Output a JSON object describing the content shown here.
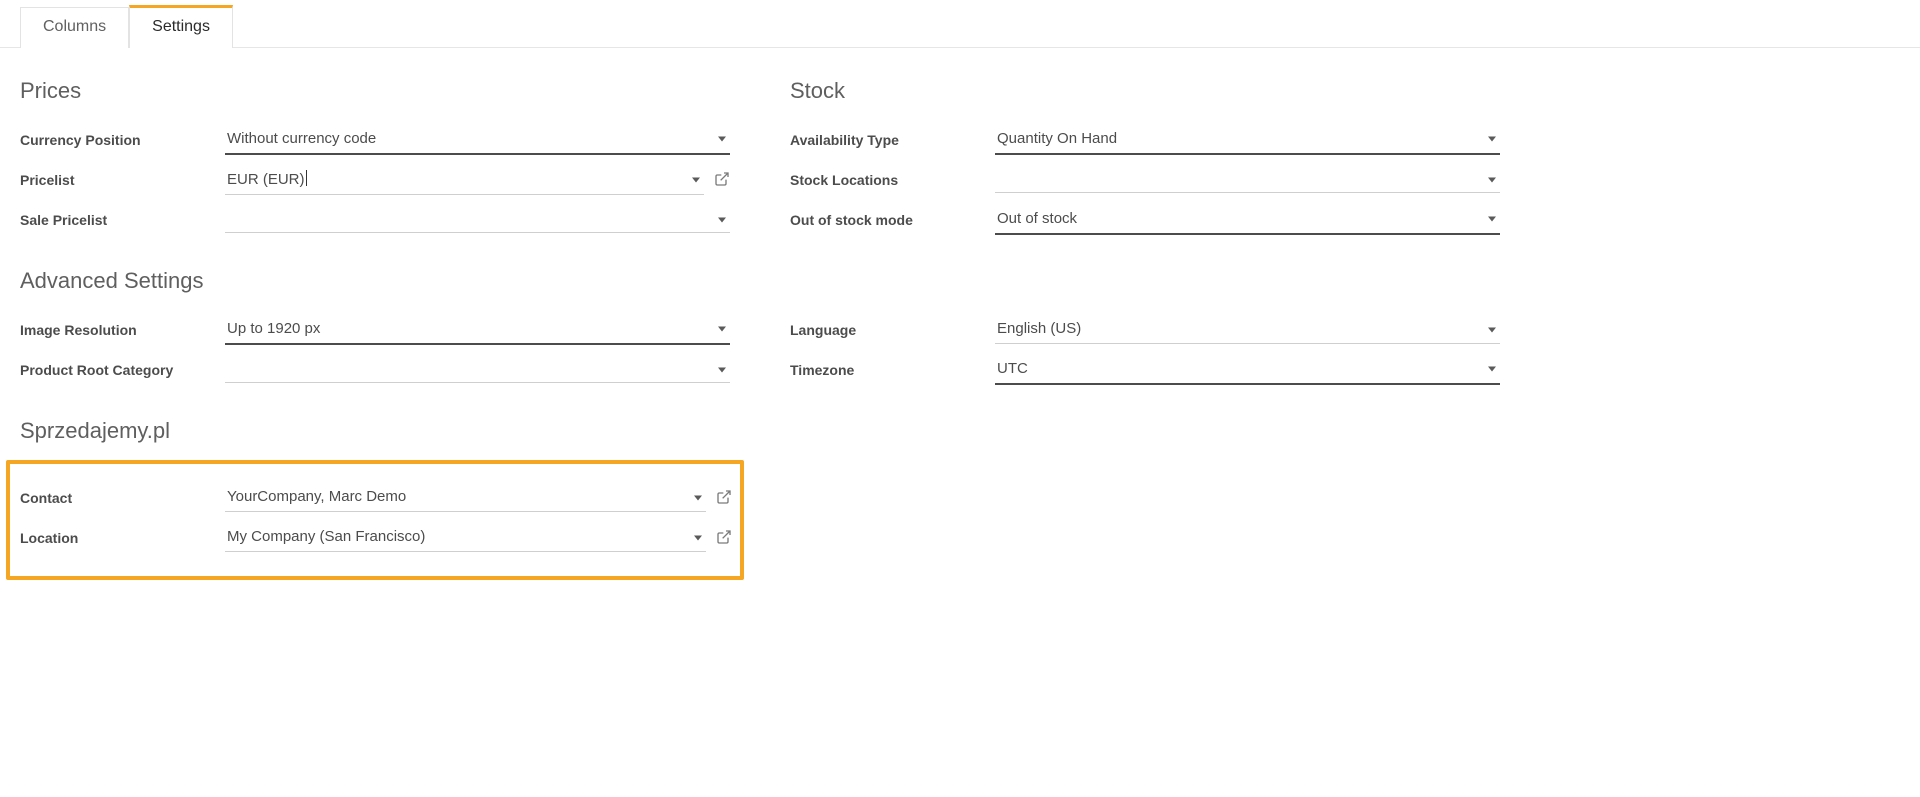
{
  "tabs": {
    "columns": "Columns",
    "settings": "Settings"
  },
  "sections": {
    "prices": "Prices",
    "stock": "Stock",
    "advanced": "Advanced Settings",
    "spr": "Sprzedajemy.pl"
  },
  "prices": {
    "currency_position": {
      "label": "Currency Position",
      "value": "Without currency code"
    },
    "pricelist": {
      "label": "Pricelist",
      "value": "EUR (EUR)"
    },
    "sale_pricelist": {
      "label": "Sale Pricelist",
      "value": ""
    }
  },
  "stock": {
    "availability_type": {
      "label": "Availability Type",
      "value": "Quantity On Hand"
    },
    "stock_locations": {
      "label": "Stock Locations",
      "value": ""
    },
    "out_of_stock": {
      "label": "Out of stock mode",
      "value": "Out of stock"
    }
  },
  "advanced": {
    "image_resolution": {
      "label": "Image Resolution",
      "value": "Up to 1920 px"
    },
    "product_root_category": {
      "label": "Product Root Category",
      "value": ""
    },
    "language": {
      "label": "Language",
      "value": "English (US)"
    },
    "timezone": {
      "label": "Timezone",
      "value": "UTC"
    }
  },
  "spr": {
    "contact": {
      "label": "Contact",
      "value": "YourCompany, Marc Demo"
    },
    "location": {
      "label": "Location",
      "value": "My Company (San Francisco)"
    }
  }
}
